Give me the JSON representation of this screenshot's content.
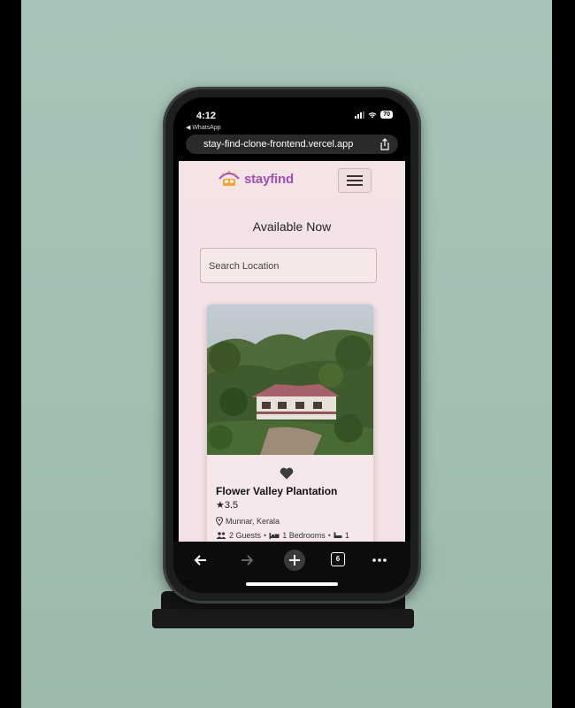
{
  "status_bar": {
    "time": "4:12",
    "back_app": "◀ WhatsApp",
    "battery": "70"
  },
  "browser": {
    "url": "stay-find-clone-frontend.vercel.app",
    "tab_count": "6"
  },
  "site": {
    "logo_text": "stayfind",
    "page_title": "Available Now",
    "search": {
      "placeholder": "Search Location",
      "value": ""
    }
  },
  "listing": {
    "name": "Flower Valley Plantation",
    "rating": "★3.5",
    "location": "Munnar, Kerala",
    "guests": "2 Guests",
    "bedrooms": "1 Bedrooms",
    "beds": "1"
  },
  "colors": {
    "brand": "#a24fb2",
    "page_bg": "#f4e3e6",
    "accent_orange": "#f2a33a"
  }
}
